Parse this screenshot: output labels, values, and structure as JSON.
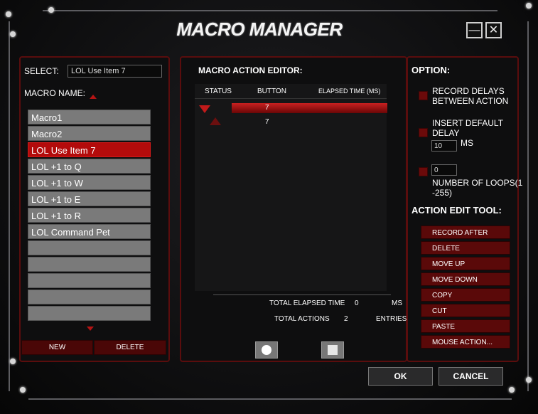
{
  "window": {
    "title": "MACRO MANAGER",
    "minimize_label": "—",
    "close_label": "✕"
  },
  "left": {
    "select_label": "SELECT:",
    "select_value": "LOL Use Item 7",
    "macro_name_label": "MACRO NAME:",
    "macros": [
      {
        "label": "Macro1",
        "selected": false
      },
      {
        "label": "Macro2",
        "selected": false
      },
      {
        "label": "LOL Use Item 7",
        "selected": true
      },
      {
        "label": "LOL +1 to Q",
        "selected": false
      },
      {
        "label": "LOL  +1 to W",
        "selected": false
      },
      {
        "label": "LOL +1 to E",
        "selected": false
      },
      {
        "label": "LOL +1 to R",
        "selected": false
      },
      {
        "label": "LOL Command Pet",
        "selected": false
      },
      {
        "label": "",
        "selected": false
      },
      {
        "label": "",
        "selected": false
      },
      {
        "label": "",
        "selected": false
      },
      {
        "label": "",
        "selected": false
      },
      {
        "label": "",
        "selected": false
      }
    ],
    "new_label": "NEW",
    "delete_label": "DELETE"
  },
  "editor": {
    "title": "MACRO ACTION EDITOR:",
    "columns": [
      "STATUS",
      "BUTTON",
      "ELAPSED TIME (MS)"
    ],
    "rows": [
      {
        "status_icon": "key-down-icon",
        "button": "7"
      },
      {
        "status_icon": "key-up-icon",
        "button": "7"
      }
    ],
    "total_elapsed_label": "TOTAL ELAPSED TIME",
    "total_elapsed_value": "0",
    "total_elapsed_unit": "MS",
    "total_actions_label": "TOTAL ACTIONS",
    "total_actions_value": "2",
    "total_actions_unit": "ENTRIES"
  },
  "option": {
    "title": "OPTION:",
    "record_delays": "RECORD DELAYS\nBETWEEN ACTION",
    "insert_default_delay": "INSERT DEFAULT\nDELAY",
    "delay_value": "10",
    "delay_unit": "MS",
    "loops_value": "0",
    "loops_label": "NUMBER OF LOOPS(1\n-255)"
  },
  "tools": {
    "title": "ACTION EDIT TOOL:",
    "buttons": [
      "RECORD AFTER",
      "DELETE",
      "MOVE UP",
      "MOVE DOWN",
      "COPY",
      "CUT",
      "PASTE",
      "MOUSE ACTION..."
    ]
  },
  "footer": {
    "ok_label": "OK",
    "cancel_label": "CANCEL"
  },
  "colors": {
    "accent_red": "#b30b0b",
    "panel_border": "#5a0d0d",
    "tool_button": "#5a0909"
  }
}
